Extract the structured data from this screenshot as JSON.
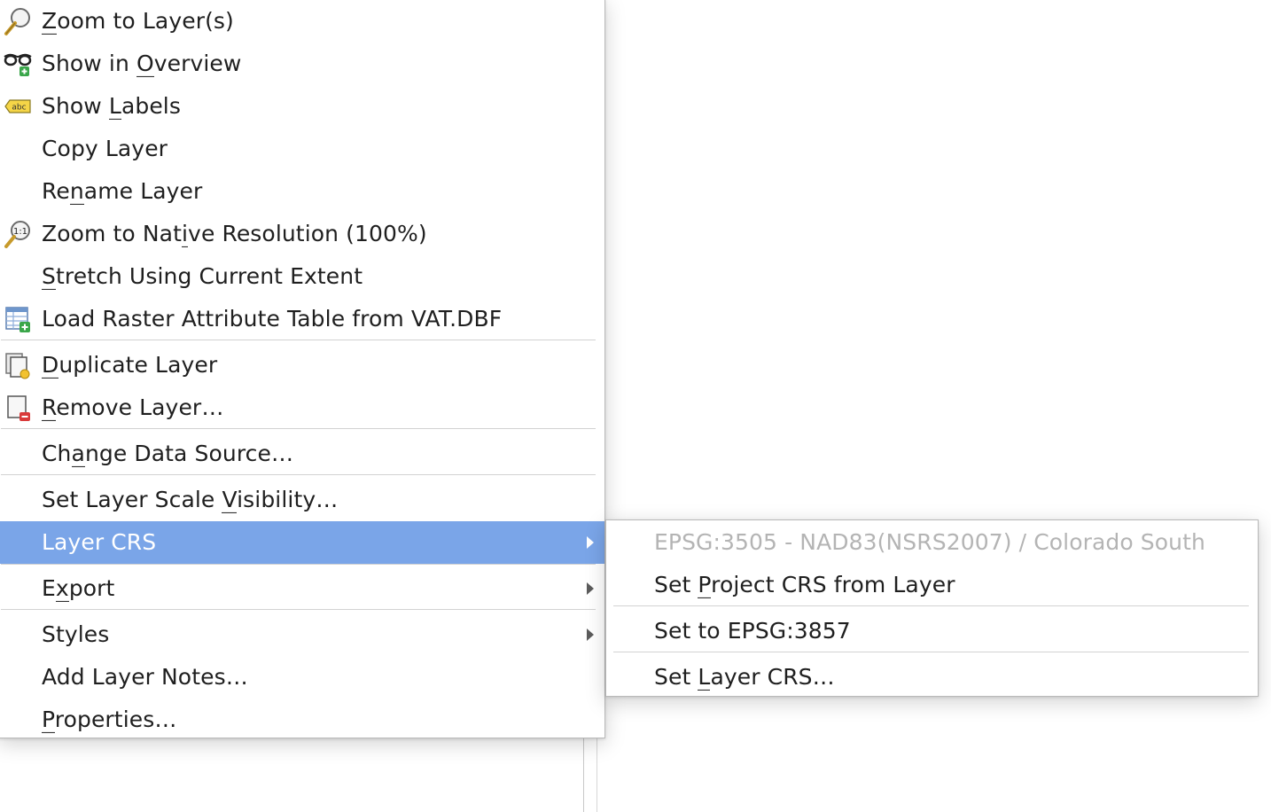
{
  "main_menu": {
    "items": [
      {
        "pre": "",
        "u": "Z",
        "post": "oom to Layer(s)",
        "icon": "zoom-to-layer-icon"
      },
      {
        "pre": "Show in ",
        "u": "O",
        "post": "verview",
        "icon": "show-in-overview-icon"
      },
      {
        "pre": "Show ",
        "u": "L",
        "post": "abels",
        "icon": "show-labels-icon",
        "icon_text": "abc"
      },
      {
        "pre": "Copy Layer",
        "u": "",
        "post": ""
      },
      {
        "pre": "Re",
        "u": "n",
        "post": "ame Layer"
      },
      {
        "pre": "Zoom to Nat",
        "u": "i",
        "post": "ve Resolution (100%)",
        "icon": "zoom-native-resolution-icon",
        "icon_text": "1:1"
      },
      {
        "pre": "",
        "u": "S",
        "post": "tretch Using Current Extent"
      },
      {
        "pre": "Load Raster Attribute Table from VAT.DBF",
        "u": "",
        "post": "",
        "icon": "raster-attribute-table-icon"
      },
      {
        "pre": "",
        "u": "D",
        "post": "uplicate Layer",
        "icon": "duplicate-layer-icon"
      },
      {
        "pre": "",
        "u": "R",
        "post": "emove Layer…",
        "icon": "remove-layer-icon"
      },
      {
        "pre": "Ch",
        "u": "a",
        "post": "nge Data Source…"
      },
      {
        "pre": "Set Layer Scale ",
        "u": "V",
        "post": "isibility…"
      },
      {
        "pre": "Layer CRS",
        "u": "",
        "post": "",
        "submenu": true,
        "selected": true
      },
      {
        "pre": "E",
        "u": "x",
        "post": "port",
        "submenu": true
      },
      {
        "pre": "Styles",
        "u": "",
        "post": "",
        "submenu": true
      },
      {
        "pre": "Add Layer Notes…",
        "u": "",
        "post": ""
      },
      {
        "pre": "",
        "u": "P",
        "post": "roperties…"
      }
    ]
  },
  "sub_menu": {
    "items": [
      {
        "pre": "EPSG:3505 - NAD83(NSRS2007) / Colorado South",
        "u": "",
        "post": "",
        "disabled": true
      },
      {
        "pre": "Set ",
        "u": "P",
        "post": "roject CRS from Layer"
      },
      {
        "pre": "Set to EPSG:3857",
        "u": "",
        "post": ""
      },
      {
        "pre": "Set ",
        "u": "L",
        "post": "ayer CRS…"
      }
    ]
  },
  "colors": {
    "selection": "#7aa5e8",
    "disabled_text": "#b4b4b4",
    "text": "#1f1f1f"
  }
}
